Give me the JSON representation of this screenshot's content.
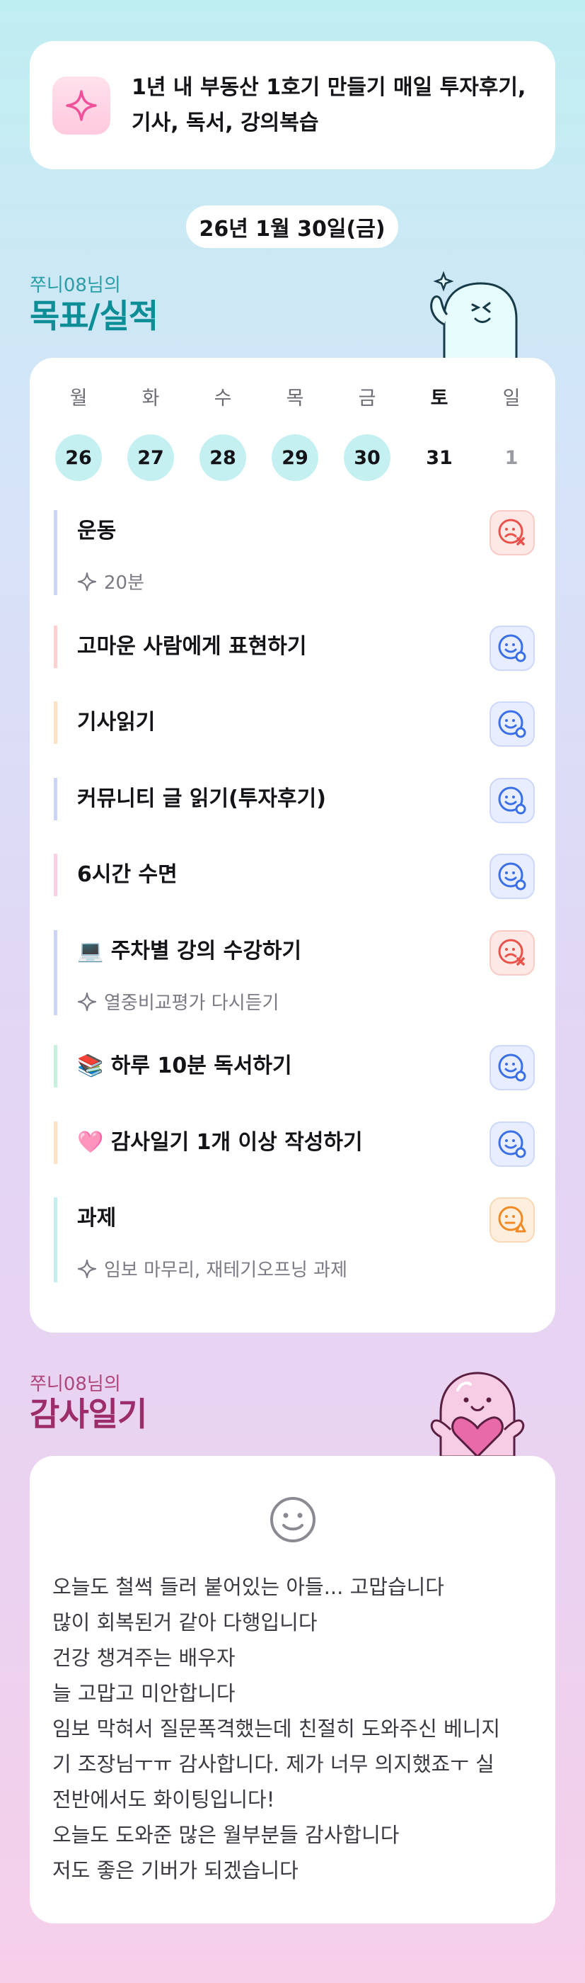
{
  "goal": {
    "icon": "sparkle-icon",
    "line1": "1년 내 부동산 1호기 만들기 매일 투자후기,",
    "line2": "기사, 독서, 강의복습"
  },
  "date": "26년 1월 30일(금)",
  "goals_section": {
    "user": "쭈니08님의",
    "title": "목표/실적"
  },
  "week": {
    "labels": [
      "월",
      "화",
      "수",
      "목",
      "금",
      "토",
      "일"
    ],
    "days": [
      "26",
      "27",
      "28",
      "29",
      "30",
      "31",
      "1"
    ]
  },
  "tasks": [
    {
      "title": "운동",
      "sub": "20분",
      "status": "fail",
      "status_icon": "sad-x-icon"
    },
    {
      "title": "고마운 사람에게 표현하기",
      "sub": "",
      "status": "ok",
      "status_icon": "smile-check-icon"
    },
    {
      "title": "기사읽기",
      "sub": "",
      "status": "ok",
      "status_icon": "smile-check-icon"
    },
    {
      "title": "커뮤니티 글 읽기(투자후기)",
      "sub": "",
      "status": "ok",
      "status_icon": "smile-check-icon"
    },
    {
      "title": "6시간 수면",
      "sub": "",
      "status": "ok",
      "status_icon": "smile-check-icon"
    },
    {
      "title": "💻 주차별 강의 수강하기",
      "sub": "열중비교평가 다시듣기",
      "status": "fail",
      "status_icon": "sad-x-icon"
    },
    {
      "title": "📚 하루 10분 독서하기",
      "sub": "",
      "status": "ok",
      "status_icon": "smile-check-icon"
    },
    {
      "title": "🩷 감사일기 1개 이상 작성하기",
      "sub": "",
      "status": "ok",
      "status_icon": "smile-check-icon"
    },
    {
      "title": "과제",
      "sub": "임보 마무리, 재테기오프닝 과제",
      "status": "warn",
      "status_icon": "meh-warning-icon"
    }
  ],
  "diary_section": {
    "user": "쭈니08님의",
    "title": "감사일기"
  },
  "diary": {
    "icon": "smile-face-icon",
    "lines": [
      "오늘도 철썩 들러 붙어있는 아들... 고맙습니다",
      "많이 회복된거 같아 다행입니다",
      "건강 챙겨주는 배우자",
      "늘 고맙고 미안합니다",
      "임보 막혀서 질문폭격했는데 친절히 도와주신 베니지",
      "기 조장님ㅜㅠ 감사합니다. 제가 너무 의지했죠ㅜ 실",
      "전반에서도 화이팅입니다!",
      "오늘도 도와준 많은 월부분들 감사합니다",
      "저도 좋은 기버가 되겠습니다"
    ]
  },
  "colors": {
    "accent_teal": "#0d8e97",
    "accent_pink": "#9c2d6a",
    "fail": "#e8524a",
    "ok": "#3a6fe8",
    "warn": "#f08a24"
  }
}
